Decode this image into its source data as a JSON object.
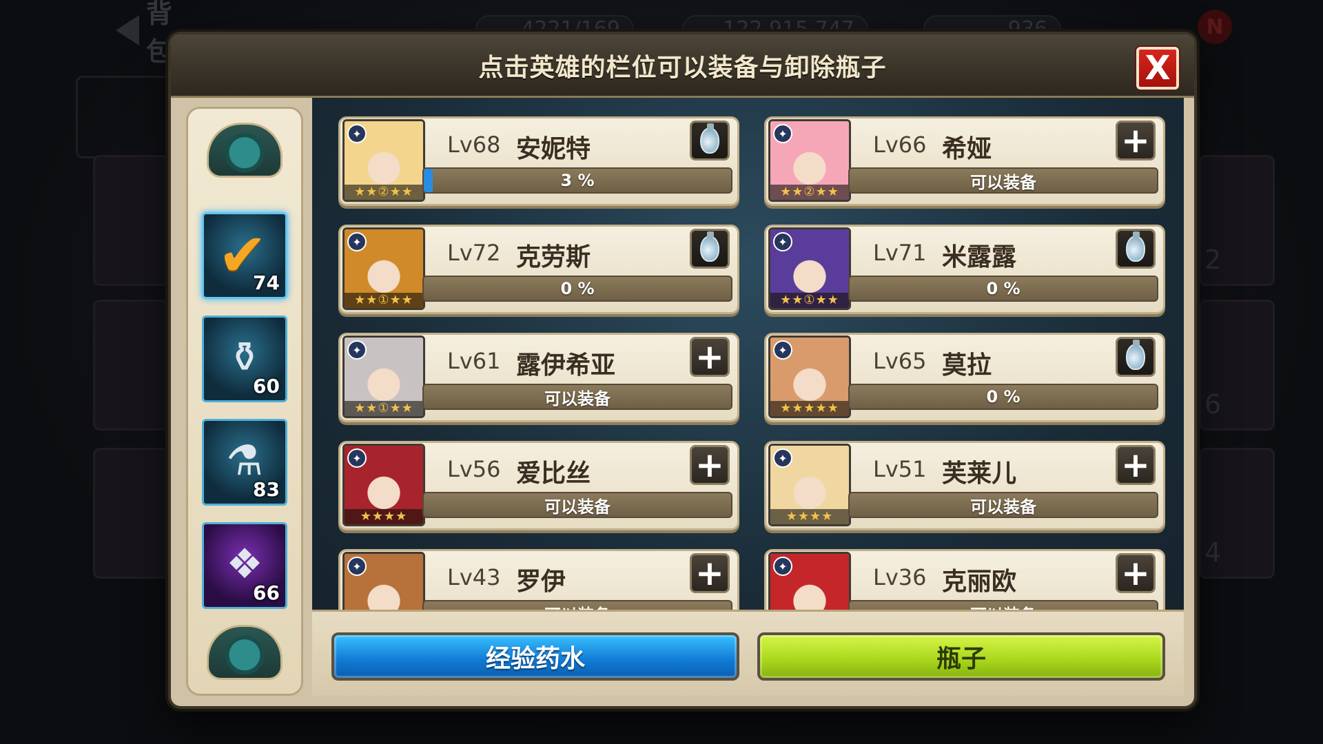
{
  "header": {
    "title": "点击英雄的栏位可以装备与卸除瓶子",
    "close_label": "X"
  },
  "background": {
    "back_label": "背包",
    "stats": [
      "4221/169",
      "122,915,747",
      "936"
    ],
    "notification": "N",
    "side_numbers": [
      "2",
      "6",
      "4"
    ]
  },
  "potions": [
    {
      "icon": "checkmark-potion-icon",
      "count": "74",
      "selected": true
    },
    {
      "icon": "bottle-icon",
      "count": "60"
    },
    {
      "icon": "flask-icon",
      "count": "83"
    },
    {
      "icon": "crystal-potion-icon",
      "count": "66"
    }
  ],
  "heroes": [
    {
      "level": "Lv68",
      "name": "安妮特",
      "status": "3 %",
      "progress": 0.03,
      "action": "potion",
      "stars": "★★②★★",
      "portrait_color": "#f4d58d"
    },
    {
      "level": "Lv66",
      "name": "希娅",
      "status": "可以装备",
      "progress": 0,
      "action": "add",
      "stars": "★★②★★",
      "portrait_color": "#f5a7b8"
    },
    {
      "level": "Lv72",
      "name": "克劳斯",
      "status": "0 %",
      "progress": 0,
      "action": "potion",
      "stars": "★★①★★",
      "portrait_color": "#d08a2a"
    },
    {
      "level": "Lv71",
      "name": "米露露",
      "status": "0 %",
      "progress": 0,
      "action": "potion",
      "stars": "★★①★★",
      "portrait_color": "#5a3c9a"
    },
    {
      "level": "Lv61",
      "name": "露伊希亚",
      "status": "可以装备",
      "progress": 0,
      "action": "add",
      "stars": "★★①★★",
      "portrait_color": "#c9c2c2"
    },
    {
      "level": "Lv65",
      "name": "莫拉",
      "status": "0 %",
      "progress": 0,
      "action": "potion",
      "stars": "★★★★★",
      "portrait_color": "#d99b6b"
    },
    {
      "level": "Lv56",
      "name": "爱比丝",
      "status": "可以装备",
      "progress": 0,
      "action": "add",
      "stars": "★★★★",
      "portrait_color": "#a8242c"
    },
    {
      "level": "Lv51",
      "name": "芙莱儿",
      "status": "可以装备",
      "progress": 0,
      "action": "add",
      "stars": "★★★★",
      "portrait_color": "#f0d6a0"
    },
    {
      "level": "Lv43",
      "name": "罗伊",
      "status": "可以装备",
      "progress": 0,
      "action": "add",
      "stars": "★★★★",
      "portrait_color": "#b7713a"
    },
    {
      "level": "Lv36",
      "name": "克丽欧",
      "status": "可以装备",
      "progress": 0,
      "action": "add",
      "stars": "★★★★",
      "portrait_color": "#c4262a"
    }
  ],
  "buttons": {
    "exp_potion": "经验药水",
    "bottle": "瓶子"
  },
  "colors": {
    "accent_blue": "#1a8de0",
    "accent_green": "#a8d61b",
    "close_red": "#c81f17"
  }
}
